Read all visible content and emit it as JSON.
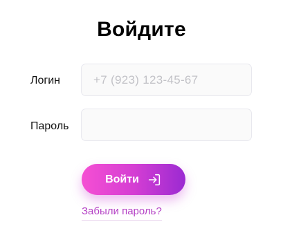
{
  "form": {
    "title": "Войдите",
    "login": {
      "label": "Логин",
      "placeholder": "+7 (923) 123-45-67",
      "value": ""
    },
    "password": {
      "label": "Пароль",
      "placeholder": "",
      "value": ""
    },
    "submit": {
      "label": "Войти",
      "icon": "sign-in-icon"
    },
    "forgot_password": "Забыли пароль?"
  },
  "colors": {
    "accent_start": "#f54fd3",
    "accent_end": "#9b2ad2",
    "link": "#b441c5",
    "input_background": "#fafafa",
    "input_border": "#e8e8ee"
  }
}
